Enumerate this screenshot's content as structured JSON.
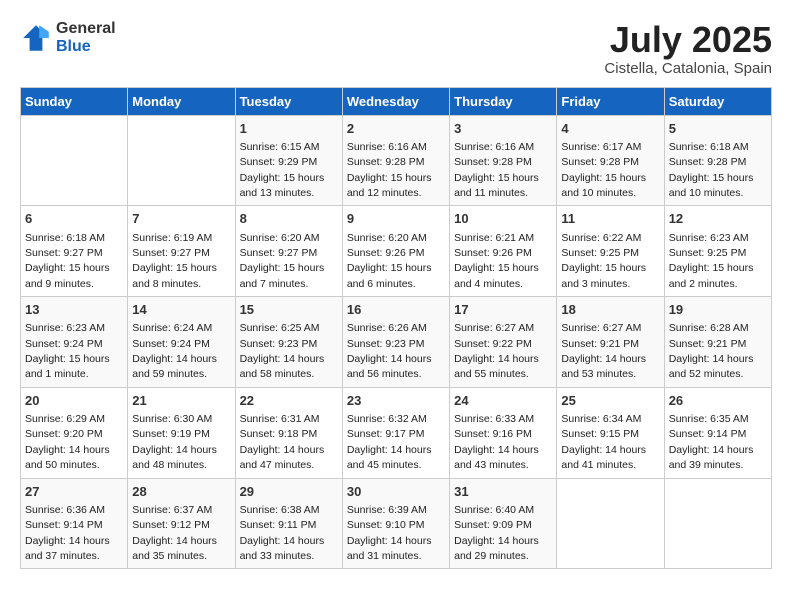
{
  "header": {
    "logo_general": "General",
    "logo_blue": "Blue",
    "month_year": "July 2025",
    "location": "Cistella, Catalonia, Spain"
  },
  "weekdays": [
    "Sunday",
    "Monday",
    "Tuesday",
    "Wednesday",
    "Thursday",
    "Friday",
    "Saturday"
  ],
  "weeks": [
    [
      {
        "day": "",
        "sunrise": "",
        "sunset": "",
        "daylight": ""
      },
      {
        "day": "",
        "sunrise": "",
        "sunset": "",
        "daylight": ""
      },
      {
        "day": "1",
        "sunrise": "Sunrise: 6:15 AM",
        "sunset": "Sunset: 9:29 PM",
        "daylight": "Daylight: 15 hours and 13 minutes."
      },
      {
        "day": "2",
        "sunrise": "Sunrise: 6:16 AM",
        "sunset": "Sunset: 9:28 PM",
        "daylight": "Daylight: 15 hours and 12 minutes."
      },
      {
        "day": "3",
        "sunrise": "Sunrise: 6:16 AM",
        "sunset": "Sunset: 9:28 PM",
        "daylight": "Daylight: 15 hours and 11 minutes."
      },
      {
        "day": "4",
        "sunrise": "Sunrise: 6:17 AM",
        "sunset": "Sunset: 9:28 PM",
        "daylight": "Daylight: 15 hours and 10 minutes."
      },
      {
        "day": "5",
        "sunrise": "Sunrise: 6:18 AM",
        "sunset": "Sunset: 9:28 PM",
        "daylight": "Daylight: 15 hours and 10 minutes."
      }
    ],
    [
      {
        "day": "6",
        "sunrise": "Sunrise: 6:18 AM",
        "sunset": "Sunset: 9:27 PM",
        "daylight": "Daylight: 15 hours and 9 minutes."
      },
      {
        "day": "7",
        "sunrise": "Sunrise: 6:19 AM",
        "sunset": "Sunset: 9:27 PM",
        "daylight": "Daylight: 15 hours and 8 minutes."
      },
      {
        "day": "8",
        "sunrise": "Sunrise: 6:20 AM",
        "sunset": "Sunset: 9:27 PM",
        "daylight": "Daylight: 15 hours and 7 minutes."
      },
      {
        "day": "9",
        "sunrise": "Sunrise: 6:20 AM",
        "sunset": "Sunset: 9:26 PM",
        "daylight": "Daylight: 15 hours and 6 minutes."
      },
      {
        "day": "10",
        "sunrise": "Sunrise: 6:21 AM",
        "sunset": "Sunset: 9:26 PM",
        "daylight": "Daylight: 15 hours and 4 minutes."
      },
      {
        "day": "11",
        "sunrise": "Sunrise: 6:22 AM",
        "sunset": "Sunset: 9:25 PM",
        "daylight": "Daylight: 15 hours and 3 minutes."
      },
      {
        "day": "12",
        "sunrise": "Sunrise: 6:23 AM",
        "sunset": "Sunset: 9:25 PM",
        "daylight": "Daylight: 15 hours and 2 minutes."
      }
    ],
    [
      {
        "day": "13",
        "sunrise": "Sunrise: 6:23 AM",
        "sunset": "Sunset: 9:24 PM",
        "daylight": "Daylight: 15 hours and 1 minute."
      },
      {
        "day": "14",
        "sunrise": "Sunrise: 6:24 AM",
        "sunset": "Sunset: 9:24 PM",
        "daylight": "Daylight: 14 hours and 59 minutes."
      },
      {
        "day": "15",
        "sunrise": "Sunrise: 6:25 AM",
        "sunset": "Sunset: 9:23 PM",
        "daylight": "Daylight: 14 hours and 58 minutes."
      },
      {
        "day": "16",
        "sunrise": "Sunrise: 6:26 AM",
        "sunset": "Sunset: 9:23 PM",
        "daylight": "Daylight: 14 hours and 56 minutes."
      },
      {
        "day": "17",
        "sunrise": "Sunrise: 6:27 AM",
        "sunset": "Sunset: 9:22 PM",
        "daylight": "Daylight: 14 hours and 55 minutes."
      },
      {
        "day": "18",
        "sunrise": "Sunrise: 6:27 AM",
        "sunset": "Sunset: 9:21 PM",
        "daylight": "Daylight: 14 hours and 53 minutes."
      },
      {
        "day": "19",
        "sunrise": "Sunrise: 6:28 AM",
        "sunset": "Sunset: 9:21 PM",
        "daylight": "Daylight: 14 hours and 52 minutes."
      }
    ],
    [
      {
        "day": "20",
        "sunrise": "Sunrise: 6:29 AM",
        "sunset": "Sunset: 9:20 PM",
        "daylight": "Daylight: 14 hours and 50 minutes."
      },
      {
        "day": "21",
        "sunrise": "Sunrise: 6:30 AM",
        "sunset": "Sunset: 9:19 PM",
        "daylight": "Daylight: 14 hours and 48 minutes."
      },
      {
        "day": "22",
        "sunrise": "Sunrise: 6:31 AM",
        "sunset": "Sunset: 9:18 PM",
        "daylight": "Daylight: 14 hours and 47 minutes."
      },
      {
        "day": "23",
        "sunrise": "Sunrise: 6:32 AM",
        "sunset": "Sunset: 9:17 PM",
        "daylight": "Daylight: 14 hours and 45 minutes."
      },
      {
        "day": "24",
        "sunrise": "Sunrise: 6:33 AM",
        "sunset": "Sunset: 9:16 PM",
        "daylight": "Daylight: 14 hours and 43 minutes."
      },
      {
        "day": "25",
        "sunrise": "Sunrise: 6:34 AM",
        "sunset": "Sunset: 9:15 PM",
        "daylight": "Daylight: 14 hours and 41 minutes."
      },
      {
        "day": "26",
        "sunrise": "Sunrise: 6:35 AM",
        "sunset": "Sunset: 9:14 PM",
        "daylight": "Daylight: 14 hours and 39 minutes."
      }
    ],
    [
      {
        "day": "27",
        "sunrise": "Sunrise: 6:36 AM",
        "sunset": "Sunset: 9:14 PM",
        "daylight": "Daylight: 14 hours and 37 minutes."
      },
      {
        "day": "28",
        "sunrise": "Sunrise: 6:37 AM",
        "sunset": "Sunset: 9:12 PM",
        "daylight": "Daylight: 14 hours and 35 minutes."
      },
      {
        "day": "29",
        "sunrise": "Sunrise: 6:38 AM",
        "sunset": "Sunset: 9:11 PM",
        "daylight": "Daylight: 14 hours and 33 minutes."
      },
      {
        "day": "30",
        "sunrise": "Sunrise: 6:39 AM",
        "sunset": "Sunset: 9:10 PM",
        "daylight": "Daylight: 14 hours and 31 minutes."
      },
      {
        "day": "31",
        "sunrise": "Sunrise: 6:40 AM",
        "sunset": "Sunset: 9:09 PM",
        "daylight": "Daylight: 14 hours and 29 minutes."
      },
      {
        "day": "",
        "sunrise": "",
        "sunset": "",
        "daylight": ""
      },
      {
        "day": "",
        "sunrise": "",
        "sunset": "",
        "daylight": ""
      }
    ]
  ]
}
